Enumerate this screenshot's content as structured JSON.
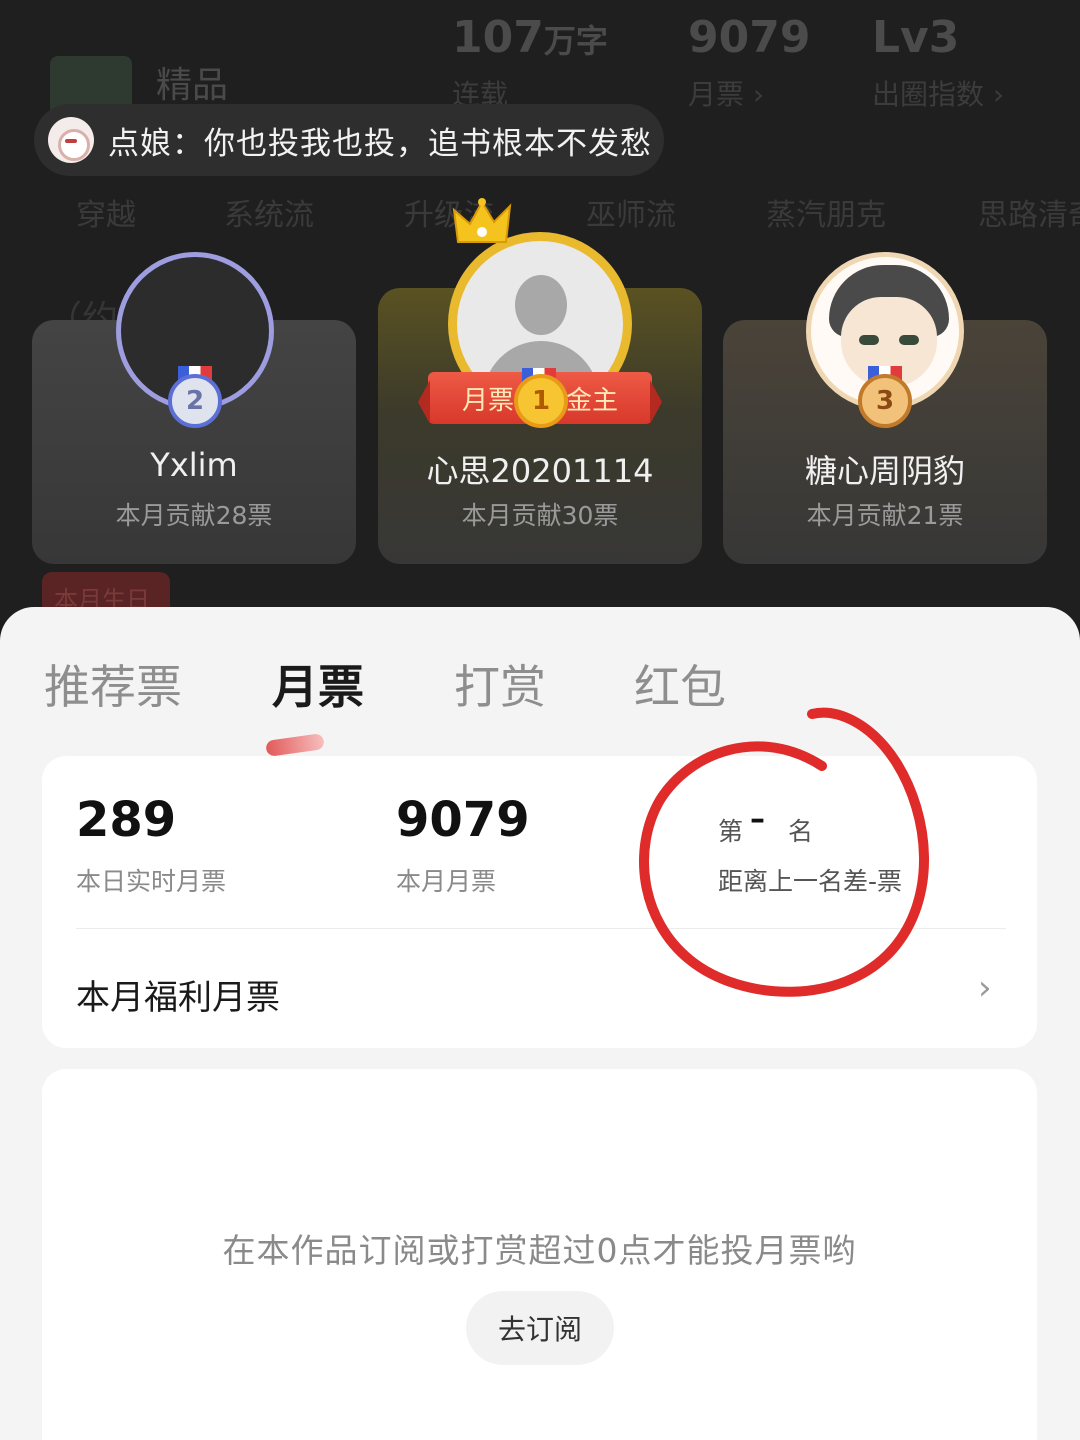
{
  "background": {
    "book_title": "精品",
    "stats": [
      {
        "value": "107",
        "unit": "万字",
        "label": "连载"
      },
      {
        "value": "9079",
        "unit": "",
        "label": "月票 ›"
      },
      {
        "value": "Lv3",
        "unit": "",
        "label": "出圈指数 ›"
      }
    ],
    "tags": [
      "穿越",
      "系统流",
      "升级流",
      "巫师流",
      "蒸汽朋克",
      "思路清奇"
    ],
    "snippet": "（约定",
    "birthday_badge": "本月生日"
  },
  "notice": {
    "text": "点娘：你也投我也投，追书根本不发愁"
  },
  "podium": {
    "first": {
      "rank": "1",
      "name": "心思20201114",
      "sub": "本月贡献30票",
      "banner_left": "月票",
      "banner_right": "金主"
    },
    "second": {
      "rank": "2",
      "name": "Yxlim",
      "sub": "本月贡献28票"
    },
    "third": {
      "rank": "3",
      "name": "糖心周阴豹",
      "sub": "本月贡献21票"
    }
  },
  "sheet": {
    "tabs": [
      "推荐票",
      "月票",
      "打赏",
      "红包"
    ],
    "active_tab": "月票",
    "daily_value": "289",
    "daily_label": "本日实时月票",
    "monthly_value": "9079",
    "monthly_label": "本月月票",
    "rank_prefix": "第",
    "rank_value": "–",
    "rank_suffix": "名",
    "rank_gap": "距离上一名差-票",
    "benefit_label": "本月福利月票",
    "benefit_chevron": "›",
    "empty_message": "在本作品订阅或打赏超过0点才能投月票哟",
    "subscribe_button": "去订阅"
  },
  "colors": {
    "accent_red": "#e23b3b",
    "gold": "#e9b92e",
    "silver_ring": "#9d9de0"
  }
}
